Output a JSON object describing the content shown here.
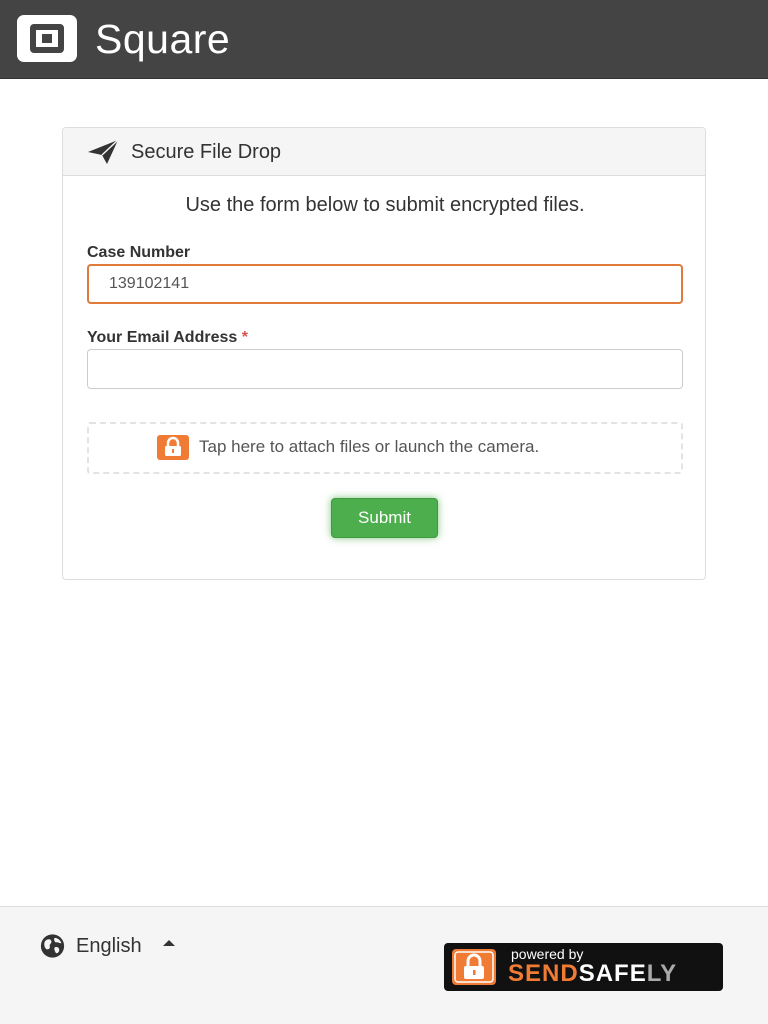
{
  "header": {
    "brand": "Square"
  },
  "panel": {
    "title": "Secure File Drop",
    "intro": "Use the form below to submit encrypted files.",
    "case_label": "Case Number",
    "case_value": "139102141",
    "email_label": "Your Email Address",
    "email_required_mark": "*",
    "email_value": "",
    "attach_text": "Tap here to attach files or launch the camera.",
    "submit_label": "Submit"
  },
  "footer": {
    "language": "English",
    "badge_small": "powered by",
    "badge_part1": "SEND",
    "badge_part2": "SAFE",
    "badge_part3": "LY"
  },
  "colors": {
    "accent_orange": "#f07b34",
    "submit_green": "#4cae4c",
    "topbar": "#444444"
  },
  "icons": [
    "square-logo-icon",
    "paper-plane-icon",
    "lock-icon",
    "globe-icon",
    "caret-up-icon",
    "sendsafely-lock-icon"
  ]
}
